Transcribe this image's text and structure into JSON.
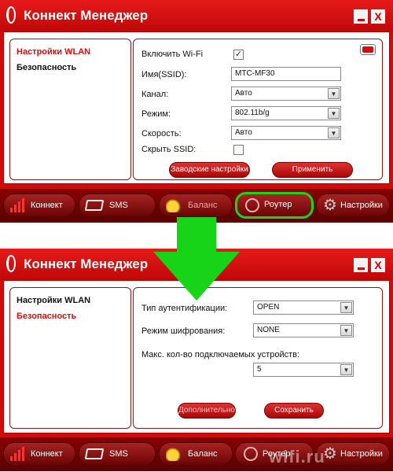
{
  "app": {
    "title": "Коннект Менеджер",
    "minimize_glyph": "_",
    "close_glyph": "X"
  },
  "colors": {
    "brand_red": "#d20a0a",
    "active_nav": "#d41010",
    "highlight_green": "#19d419",
    "arrow_green": "#18d418"
  },
  "icons": {
    "signal": "signal-bars-icon",
    "sms": "envelope-icon",
    "balance": "coins-icon",
    "router": "antenna-icon",
    "settings": "gear-icon",
    "flag": "flag-icon"
  },
  "screen1": {
    "nav": [
      {
        "label": "Настройки WLAN",
        "active": true
      },
      {
        "label": "Безопасность",
        "active": false
      }
    ],
    "form": {
      "wifi_label": "Включить Wi-Fi",
      "wifi_checked": "✓",
      "ssid_label": "Имя(SSID):",
      "ssid_value": "MTC-MF30",
      "channel_label": "Канал:",
      "channel_value": "Авто",
      "mode_label": "Режим:",
      "mode_value": "802.11b/g",
      "speed_label": "Скорость:",
      "speed_value": "Авто",
      "hide_ssid_label": "Скрыть SSID:",
      "hide_ssid_checked": "",
      "factory_button": "Заводские настройки",
      "apply_button": "Применить"
    },
    "tabs": [
      {
        "label": "Коннект"
      },
      {
        "label": "SMS"
      },
      {
        "label": "Баланс"
      },
      {
        "label": "Роутер"
      },
      {
        "label": "Настройки"
      }
    ]
  },
  "screen2": {
    "nav": [
      {
        "label": "Настройки WLAN",
        "active": false
      },
      {
        "label": "Безопасность",
        "active": true
      }
    ],
    "form": {
      "auth_label": "Тип аутентификации:",
      "auth_value": "OPEN",
      "encryption_label": "Режим шифрования:",
      "encryption_value": "NONE",
      "max_devices_label": "Макс. кол-во подключаемых устройств:",
      "max_devices_value": "5",
      "advanced_button": "Дополнительно",
      "save_button": "Сохранить"
    },
    "tabs": [
      {
        "label": "Коннект"
      },
      {
        "label": "SMS"
      },
      {
        "label": "Баланс"
      },
      {
        "label": "Роутер"
      },
      {
        "label": "Настройки"
      }
    ]
  },
  "watermark": "wifi.ru"
}
